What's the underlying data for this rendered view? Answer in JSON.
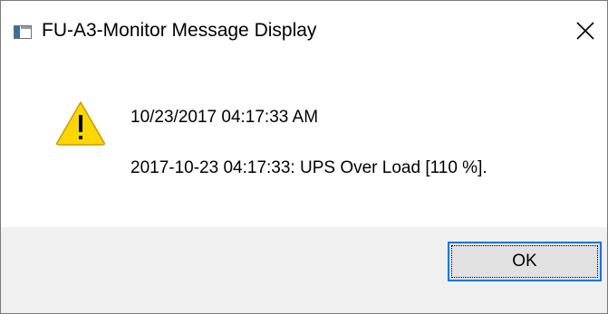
{
  "window": {
    "title": "FU-A3-Monitor Message Display",
    "app_icon": "app-window-icon",
    "close_icon": "close-icon"
  },
  "message": {
    "icon": "warning-icon",
    "timestamp": "10/23/2017 04:17:33 AM",
    "text": "2017-10-23 04:17:33: UPS Over Load [110 %]."
  },
  "buttons": {
    "ok_label": "OK"
  },
  "colors": {
    "warning_fill": "#ffd700",
    "warning_stroke": "#c89a00",
    "button_focus_border": "#0078d7",
    "footer_bg": "#f0f0f0"
  }
}
